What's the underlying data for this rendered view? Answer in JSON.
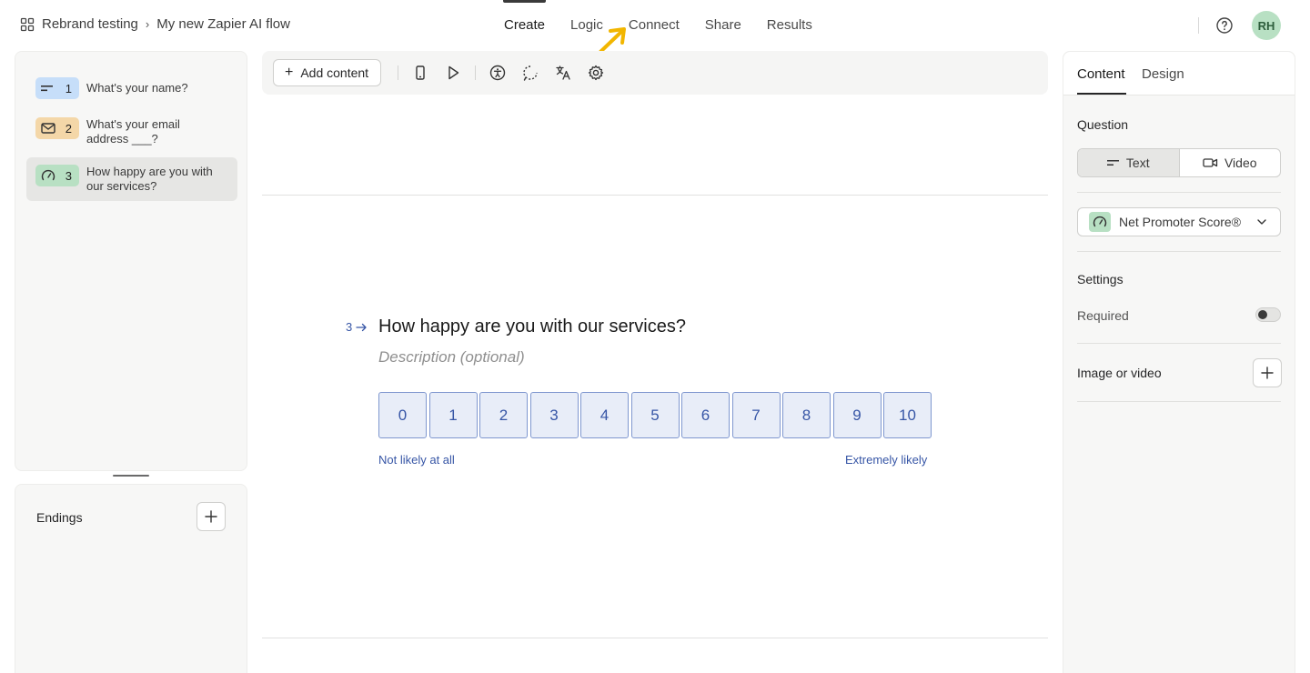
{
  "breadcrumb": {
    "workspace": "Rebrand testing",
    "form": "My new Zapier AI flow"
  },
  "nav": {
    "tabs": [
      "Create",
      "Logic",
      "Connect",
      "Share",
      "Results"
    ],
    "active": "Create"
  },
  "user": {
    "initials": "RH"
  },
  "questions": [
    {
      "number": "1",
      "label": "What's your name?",
      "type_icon": "short-text-icon",
      "color": "#c6def9"
    },
    {
      "number": "2",
      "label": "What's your email address ___?",
      "type_icon": "envelope-icon",
      "color": "#f4d7a8"
    },
    {
      "number": "3",
      "label": "How happy are you with our services?",
      "type_icon": "gauge-icon",
      "color": "#b8e0c3"
    }
  ],
  "endings": {
    "title": "Endings"
  },
  "toolbar": {
    "add_content": "Add content",
    "icons": [
      "mobile-preview-icon",
      "play-icon",
      "accessibility-icon",
      "dotted-loop-icon",
      "translate-icon",
      "settings-icon"
    ]
  },
  "canvas": {
    "question_number": "3",
    "question_title": "How happy are you with our services?",
    "description_placeholder": "Description (optional)",
    "scale": [
      "0",
      "1",
      "2",
      "3",
      "4",
      "5",
      "6",
      "7",
      "8",
      "9",
      "10"
    ],
    "label_low": "Not likely at all",
    "label_high": "Extremely likely",
    "accent_color": "#3756a6"
  },
  "right_panel": {
    "tabs": [
      "Content",
      "Design"
    ],
    "active_tab": "Content",
    "question_heading": "Question",
    "media_options": [
      "Text",
      "Video"
    ],
    "media_selected": "Text",
    "question_type": "Net Promoter Score®",
    "settings_heading": "Settings",
    "required_label": "Required",
    "required_on": false,
    "image_video_label": "Image or video"
  }
}
